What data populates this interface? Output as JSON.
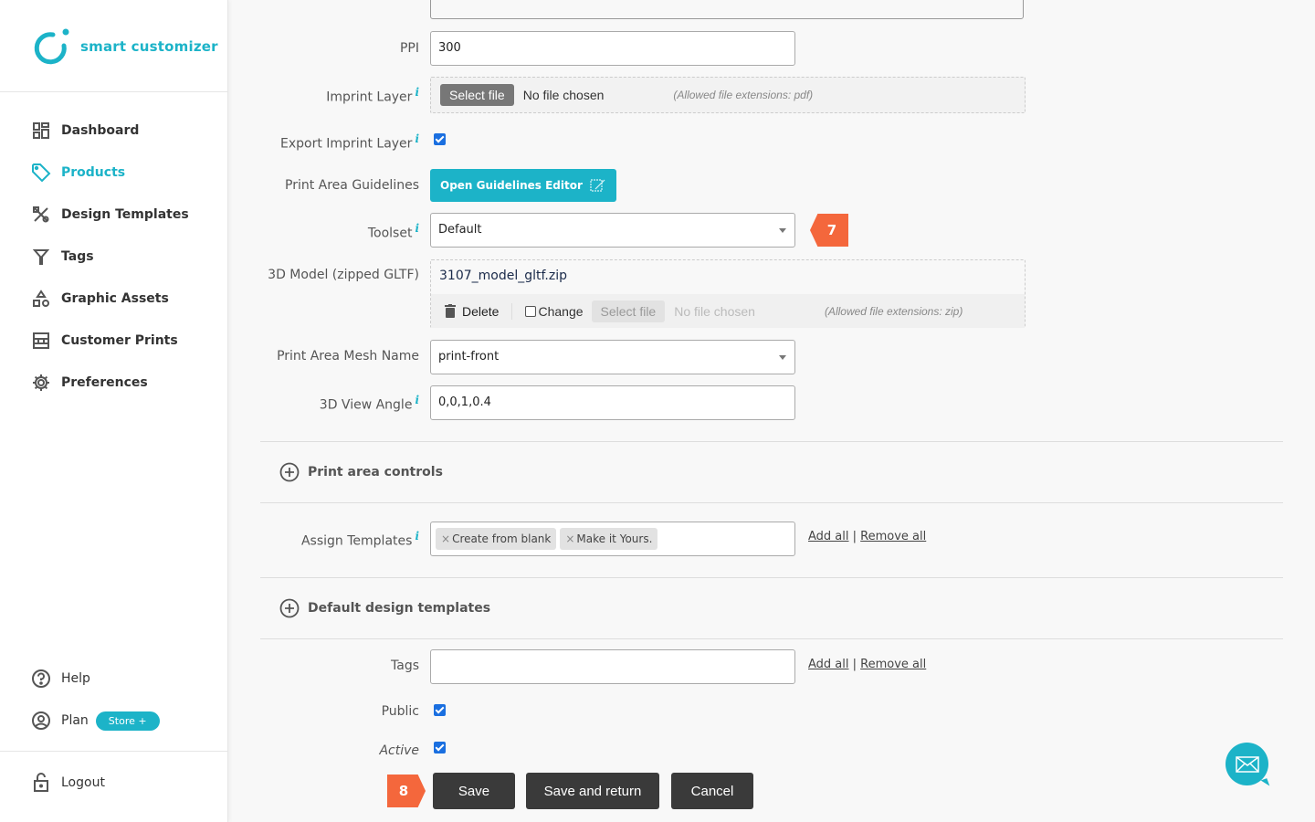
{
  "app": {
    "brand_name": "smart customizer",
    "accent_color": "#1cb3c8",
    "marker_color": "#f4673c"
  },
  "sidebar": {
    "items": [
      {
        "label": "Dashboard",
        "icon": "dashboard-icon",
        "active": false
      },
      {
        "label": "Products",
        "icon": "tag-icon",
        "active": true
      },
      {
        "label": "Design Templates",
        "icon": "design-tools-icon",
        "active": false
      },
      {
        "label": "Tags",
        "icon": "filter-icon",
        "active": false
      },
      {
        "label": "Graphic Assets",
        "icon": "shapes-icon",
        "active": false
      },
      {
        "label": "Customer Prints",
        "icon": "prints-icon",
        "active": false
      },
      {
        "label": "Preferences",
        "icon": "gear-icon",
        "active": false
      }
    ],
    "bottom": [
      {
        "label": "Help",
        "icon": "help-circle-icon"
      },
      {
        "label": "Plan",
        "icon": "user-circle-icon",
        "badge": "Store +"
      }
    ],
    "logout": {
      "label": "Logout",
      "icon": "lock-icon"
    }
  },
  "form": {
    "ppi": {
      "label": "PPI",
      "value": "300"
    },
    "imprint_layer": {
      "label": "Imprint Layer",
      "button": "Select file",
      "status": "No file chosen",
      "hint": "(Allowed file extensions: pdf)"
    },
    "export_imprint_layer": {
      "label": "Export Imprint Layer",
      "checked": true
    },
    "print_area_guidelines": {
      "label": "Print Area Guidelines",
      "button": "Open Guidelines Editor"
    },
    "toolset": {
      "label": "Toolset",
      "value": "Default"
    },
    "model_3d": {
      "label": "3D Model (zipped GLTF)",
      "filename": "3107_model_gltf.zip",
      "delete_label": "Delete",
      "change_label": "Change",
      "change_checked": false,
      "button": "Select file",
      "status": "No file chosen",
      "hint": "(Allowed file extensions: zip)"
    },
    "mesh_name": {
      "label": "Print Area Mesh Name",
      "value": "print-front"
    },
    "view_angle": {
      "label": "3D View Angle",
      "value": "0,0,1,0.4"
    },
    "section_print_area_controls": "Print area controls",
    "assign_templates": {
      "label": "Assign Templates",
      "chips": [
        "Create from blank",
        "Make it Yours."
      ]
    },
    "section_default_templates": "Default design templates",
    "tags": {
      "label": "Tags",
      "value": ""
    },
    "links": {
      "add_all": "Add all",
      "separator": "|",
      "remove_all": "Remove all"
    },
    "public": {
      "label": "Public",
      "checked": true
    },
    "active": {
      "label": "Active",
      "checked": true
    }
  },
  "markers": {
    "toolset": "7",
    "save": "8"
  },
  "actions": {
    "save": "Save",
    "save_return": "Save and return",
    "cancel": "Cancel"
  },
  "chat": {
    "icon": "mail-icon"
  }
}
